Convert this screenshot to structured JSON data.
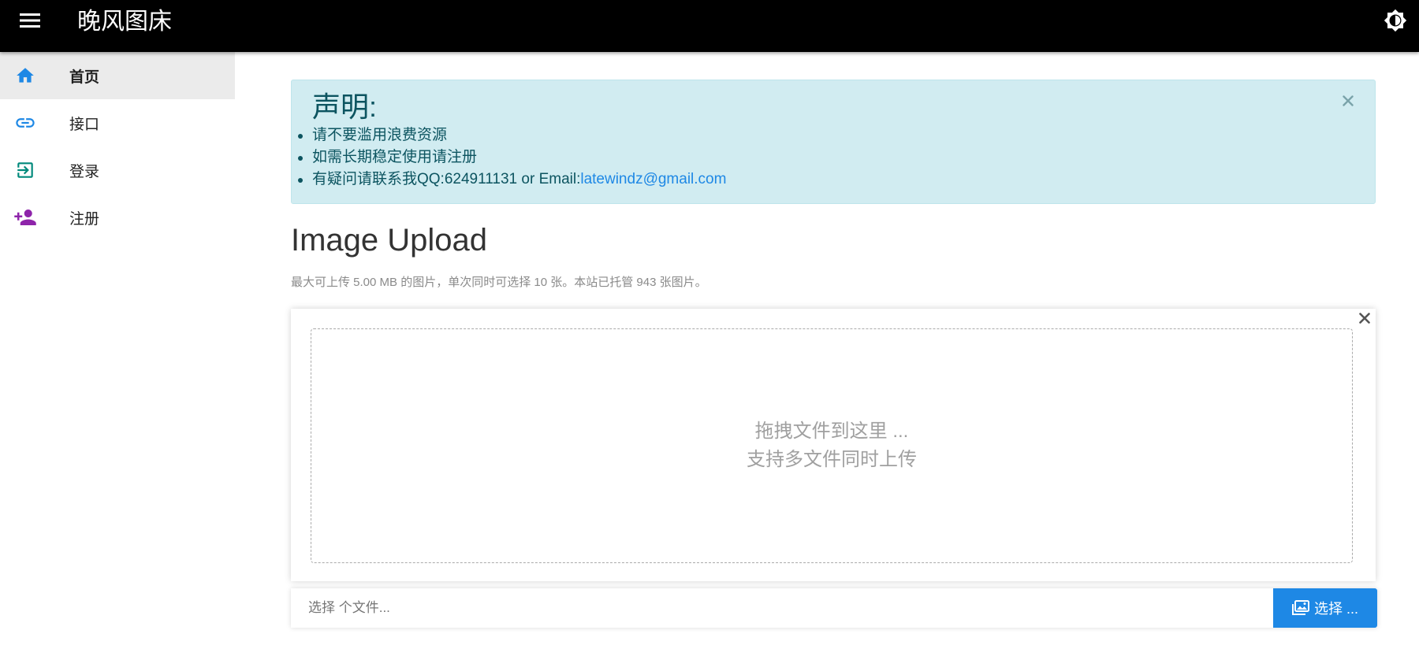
{
  "header": {
    "title": "晚风图床",
    "menu_icon": "menu-icon",
    "theme_icon": "brightness-icon"
  },
  "sidebar": {
    "items": [
      {
        "label": "首页",
        "icon": "home-icon",
        "active": true,
        "icon_color": "#1e88e5"
      },
      {
        "label": "接口",
        "icon": "link-icon",
        "active": false,
        "icon_color": "#1e88e5"
      },
      {
        "label": "登录",
        "icon": "login-icon",
        "active": false,
        "icon_color": "#00897b"
      },
      {
        "label": "注册",
        "icon": "person-add-icon",
        "active": false,
        "icon_color": "#8e24aa"
      }
    ]
  },
  "notice": {
    "title": "声明:",
    "items": [
      "请不要滥用浪费资源",
      "如需长期稳定使用请注册"
    ],
    "contact_prefix": "有疑问请联系我QQ:624911131 or Email:",
    "contact_email": "latewindz@gmail.com",
    "bg_color": "#d1ecf1",
    "text_color": "#0c5460"
  },
  "upload": {
    "heading": "Image Upload",
    "subtitle": "最大可上传 5.00 MB 的图片，单次同时可选择 10 张。本站已托管 943 张图片。",
    "drop_line1": "拖拽文件到这里 ...",
    "drop_line2": "支持多文件同时上传",
    "file_placeholder": "选择 个文件...",
    "browse_label": "选择 ...",
    "accent_color": "#1e88e5"
  }
}
